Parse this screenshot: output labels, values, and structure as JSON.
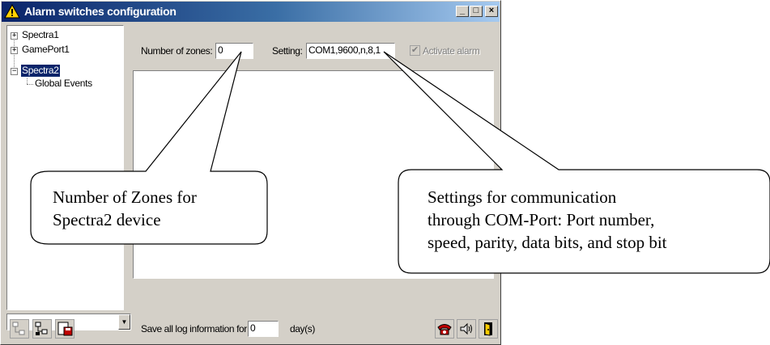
{
  "window": {
    "title": "Alarm switches configuration",
    "buttons": {
      "minimize": "_",
      "maximize": "□",
      "close": "×"
    }
  },
  "tree": {
    "items": [
      {
        "label": "Spectra1",
        "expander": "+"
      },
      {
        "label": "GamePort1",
        "expander": "+"
      },
      {
        "label": "Spectra2",
        "expander": "−",
        "selected": true
      },
      {
        "label": "Global Events"
      }
    ]
  },
  "settings": {
    "zones_label": "Number of zones:",
    "zones_value": "0",
    "setting_label": "Setting:",
    "setting_value": "COM1,9600,n,8,1",
    "activate_alarm_label": "Activate alarm",
    "activate_alarm_checked": true
  },
  "bottom": {
    "combo_value": "",
    "log_label": "Save all log information for",
    "log_days_value": "0",
    "days_unit": "day(s)"
  },
  "callouts": {
    "zones_text_line1": "Number of Zones for",
    "zones_text_line2": "Spectra2 device",
    "settings_text_line1": "Settings for communication",
    "settings_text_line2": "through COM-Port: Port number,",
    "settings_text_line3": "speed, parity, data bits, and stop bit"
  },
  "colors": {
    "titlebar_start": "#0a246a",
    "titlebar_end": "#a6caf0",
    "window_face": "#d4d0c8",
    "selection": "#0a246a"
  },
  "icons": [
    "warning-icon",
    "tree-collapse-icon",
    "tree-expand-icon",
    "save-log-icon",
    "phone-alarm-icon",
    "speaker-icon",
    "exit-door-icon"
  ]
}
